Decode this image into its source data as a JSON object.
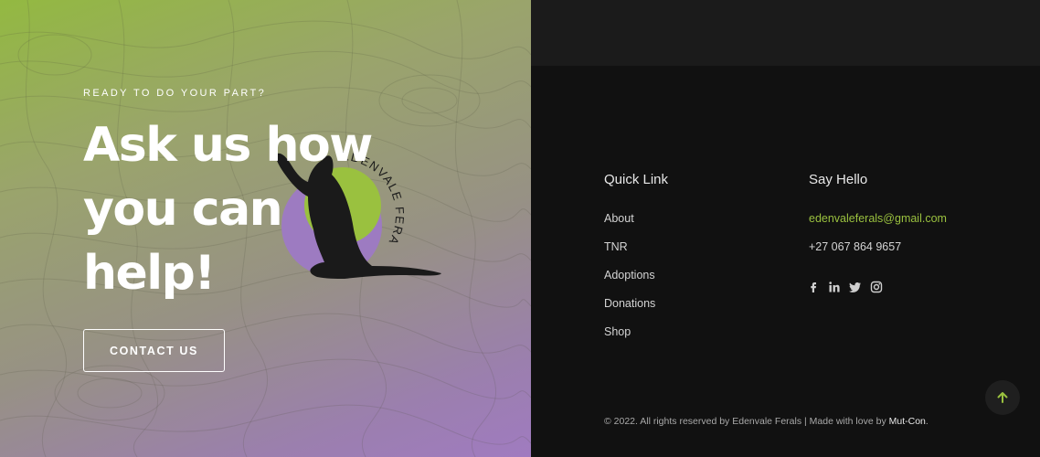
{
  "hero": {
    "eyebrow": "READY TO DO YOUR PART?",
    "headline_lines": [
      "Ask us how",
      "you can",
      "help!"
    ],
    "contact_button": "CONTACT US",
    "logo_text": "EDENVALE FERALS"
  },
  "footer": {
    "quick_link_title": "Quick Link",
    "quick_links": [
      "About",
      "TNR",
      "Adoptions",
      "Donations",
      "Shop"
    ],
    "say_hello_title": "Say Hello",
    "email": "edenvaleferals@gmail.com",
    "phone": "+27 067 864 9657",
    "social_icons": [
      "facebook-icon",
      "linkedin-icon",
      "twitter-icon",
      "instagram-icon"
    ],
    "copyright_prefix": "© 2022. All rights reserved by Edenvale Ferals | Made with love by ",
    "copyright_brand": "Mut-Con",
    "copyright_suffix": "."
  },
  "colors": {
    "accent_green": "#9ac13f",
    "hero_purple": "#a07bc0",
    "footer_bg": "#111111"
  }
}
